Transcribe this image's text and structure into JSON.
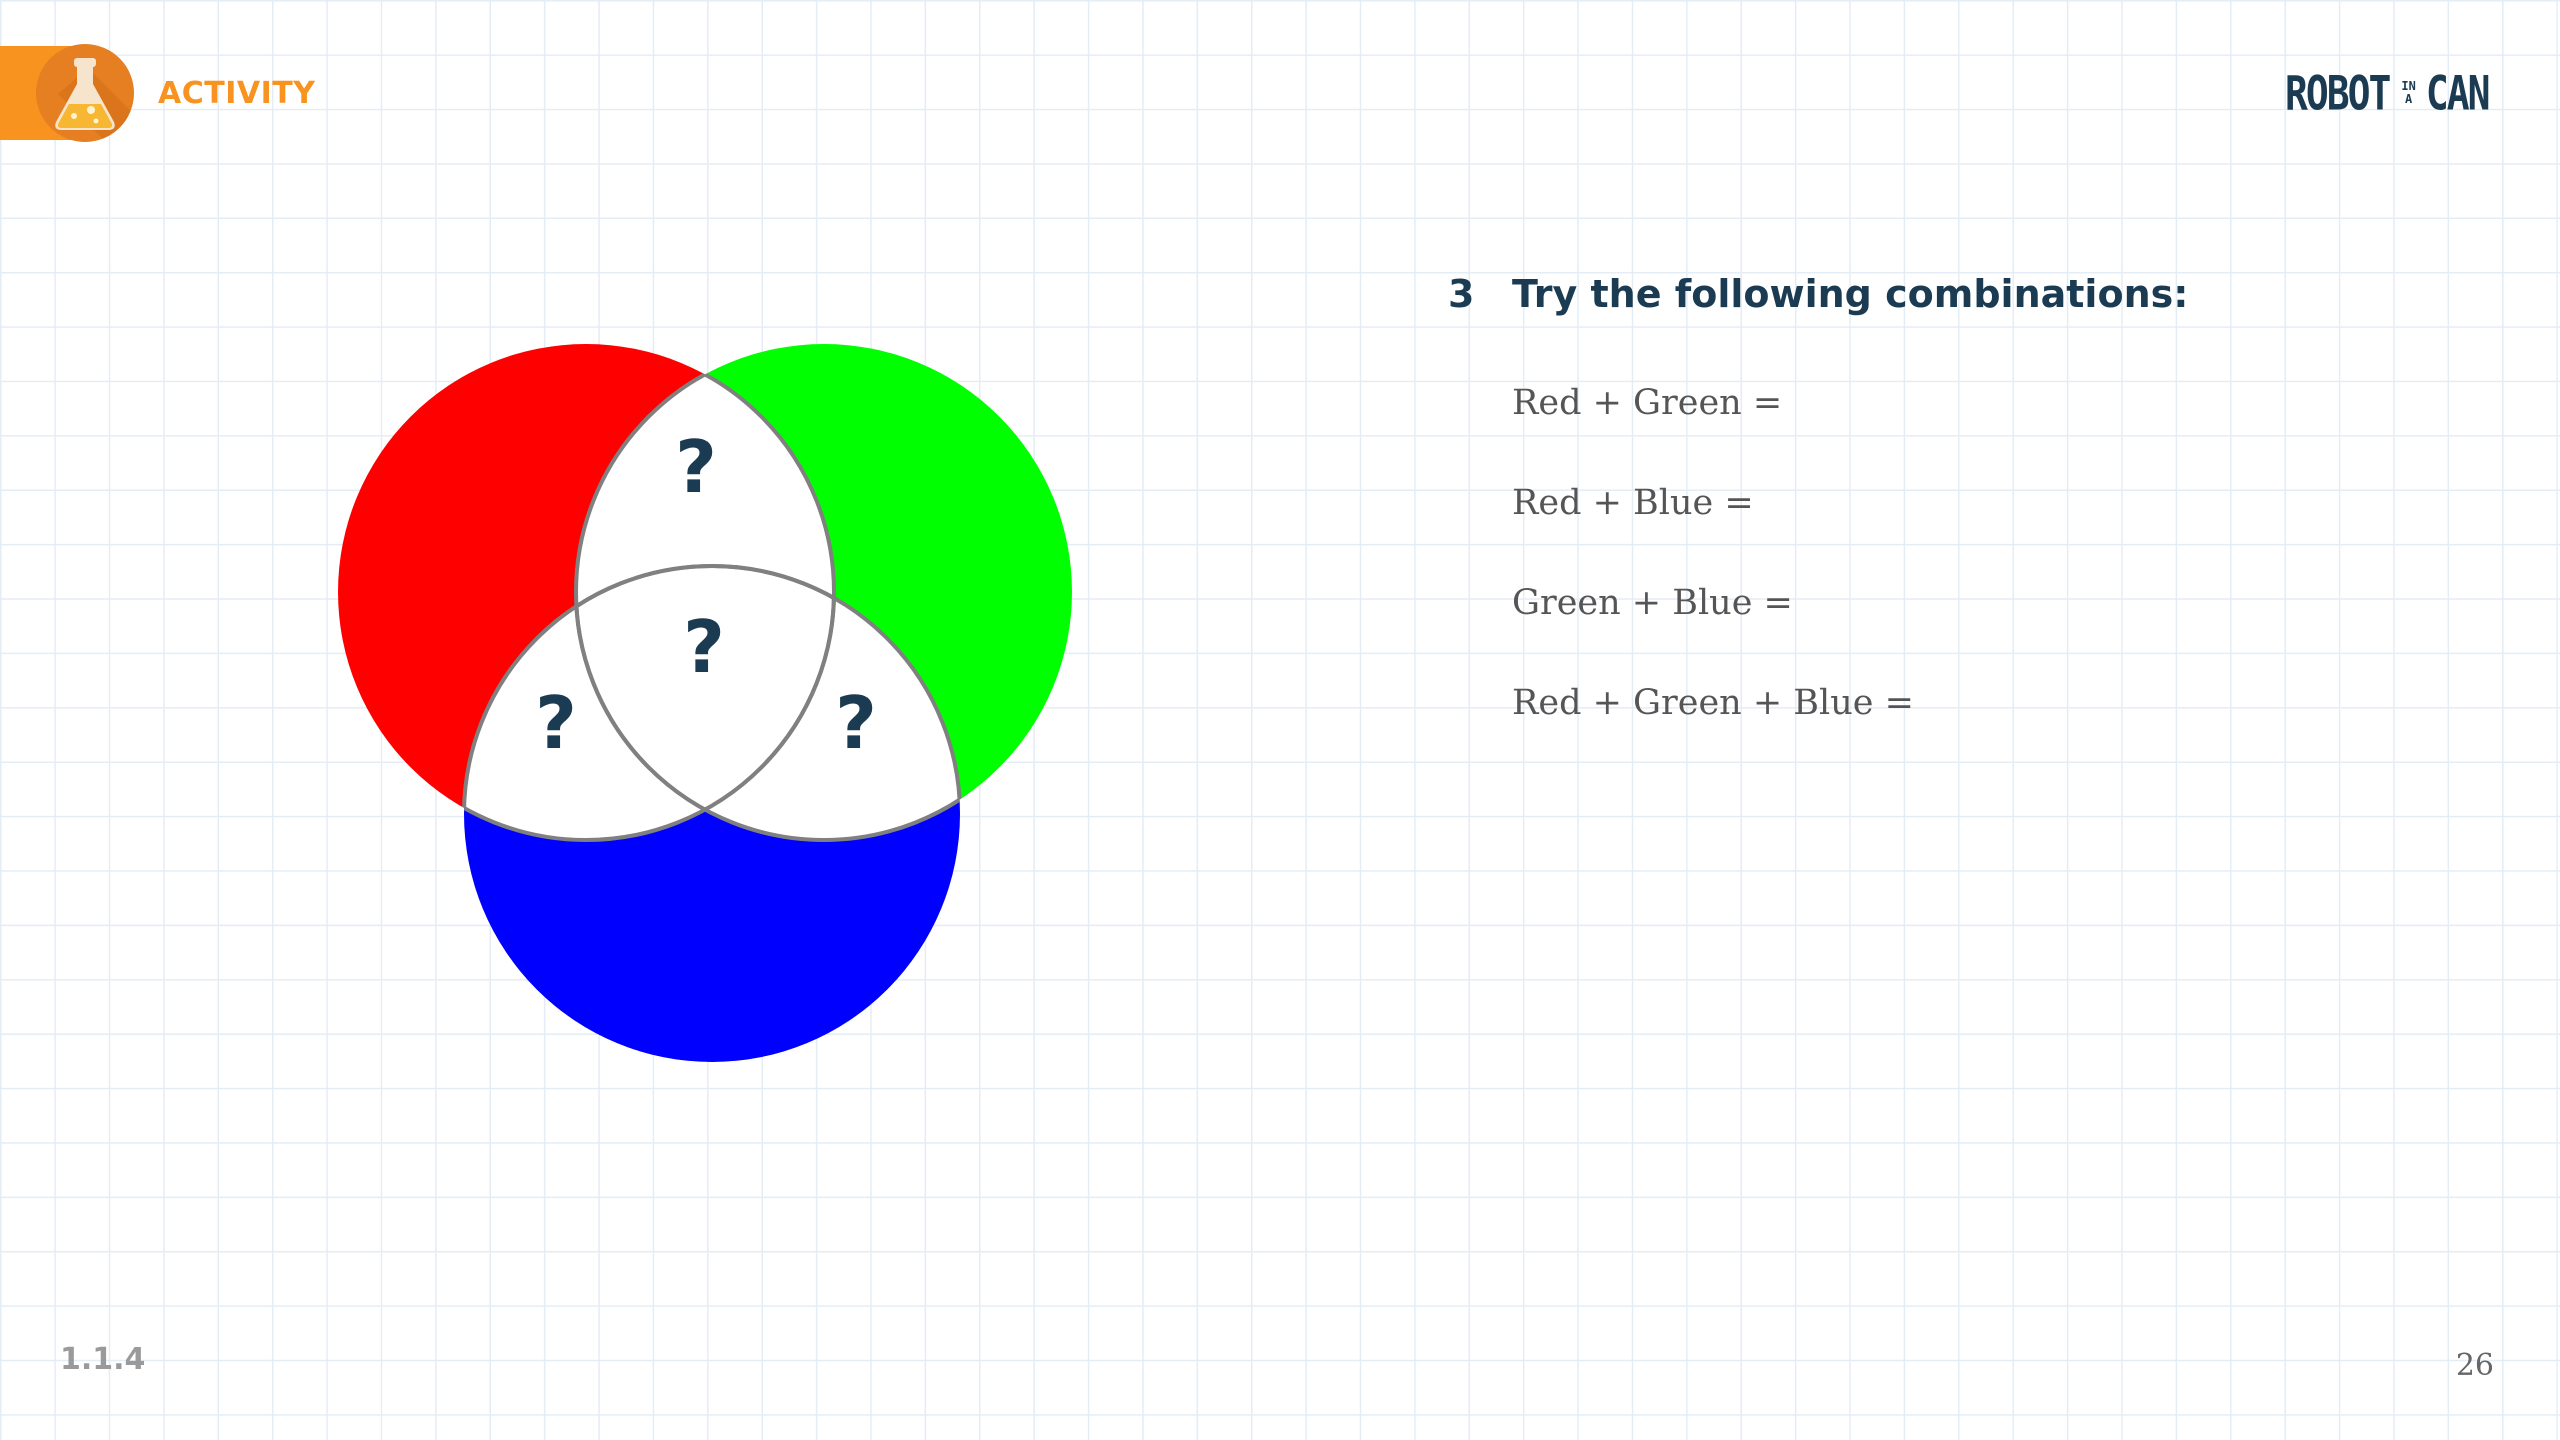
{
  "header": {
    "activity_label": "ACTIVITY",
    "activity_icon": "flask-icon",
    "accent_color": "#f7931e",
    "logo": {
      "word1": "ROBOT",
      "small_top": "IN",
      "small_bottom": "A",
      "word2": "CAN",
      "color": "#1b3b52"
    }
  },
  "venn": {
    "circles": [
      {
        "name": "Red",
        "color": "#ff0000"
      },
      {
        "name": "Green",
        "color": "#00ff00"
      },
      {
        "name": "Blue",
        "color": "#0000ff"
      }
    ],
    "overlap_fill": "#ffffff",
    "outline_color": "#808080",
    "question_mark": "?"
  },
  "instructions": {
    "step_number": "3",
    "heading": "Try the following combinations:",
    "combinations": [
      "Red + Green =",
      "Red + Blue =",
      "Green + Blue =",
      "Red + Green + Blue ="
    ]
  },
  "footer": {
    "section_code": "1.1.4",
    "page_number": "26"
  }
}
